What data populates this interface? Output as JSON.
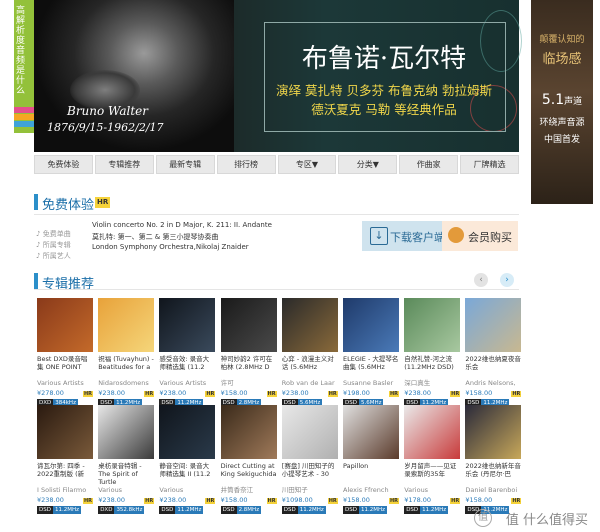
{
  "left_strip": {
    "text": "高解析度音频是什么",
    "tab_colors": [
      "#e44f8d",
      "#f5a623",
      "#3fa3d9",
      "#8b5ec8"
    ]
  },
  "banner": {
    "name": "Bruno Walter",
    "dates": "1876/9/15-1962/2/17",
    "title": "布鲁诺·瓦尔特",
    "line1": "演绎 莫扎特 贝多芬 布鲁克纳 勃拉姆斯",
    "line2": "德沃夏克 马勒 等经典作品"
  },
  "right_ad": {
    "t1": "颠覆认知的",
    "t2": "临场感",
    "t3_main": "5.1",
    "t3_small": "声道",
    "t4": "环绕声音源",
    "t5": "中国首发"
  },
  "nav": [
    {
      "label": "免费体验"
    },
    {
      "label": "专辑推荐"
    },
    {
      "label": "最新专辑"
    },
    {
      "label": "排行榜"
    },
    {
      "label": "专区▼"
    },
    {
      "label": "分类▼"
    },
    {
      "label": "作曲家"
    },
    {
      "label": "厂牌精选"
    }
  ],
  "free_trial": {
    "title": "免费体验",
    "badge": "HR",
    "rows": [
      {
        "key": "♪ 免费单曲",
        "value": "Violin concerto No. 2 in D Major, K. 211: II. Andante"
      },
      {
        "key": "♪ 所属专辑",
        "value": "莫扎特: 第一、第二 & 第三小提琴协奏曲"
      },
      {
        "key": "♪ 所属艺人",
        "value": "London Symphony Orchestra,Nikolaj Znaider"
      }
    ],
    "download_label": "下载客户端",
    "vip_label": "会员购买"
  },
  "recommend": {
    "title": "专辑推荐",
    "prev": "‹",
    "next": "›"
  },
  "albums": [
    {
      "title": "Best DXD录音唱集 ONE POINT",
      "artist": "Various Artists",
      "price": "¥278.00",
      "fmt_l": "DXD",
      "fmt_r": "384kHz",
      "colors": [
        "#8a3a1a",
        "#c46a2a"
      ]
    },
    {
      "title": "祝福 (Tuvayhun) - Beatitudes for a",
      "artist": "Nidarosdomens",
      "price": "¥238.00",
      "fmt_l": "DSD",
      "fmt_r": "11.2MHz",
      "colors": [
        "#e8a23a",
        "#f5d67a"
      ]
    },
    {
      "title": "感受音效: 录音大师精选集 (11.2",
      "artist": "Various Artists",
      "price": "¥238.00",
      "fmt_l": "DSD",
      "fmt_r": "11.2MHz",
      "colors": [
        "#10151c",
        "#3a4a5c"
      ]
    },
    {
      "title": "神司妙韵2 许可在柏林 (2.8MHz D",
      "artist": "许可",
      "price": "¥158.00",
      "fmt_l": "DSD",
      "fmt_r": "2.8MHz",
      "colors": [
        "#1a1a1a",
        "#4a4a4a"
      ]
    },
    {
      "title": "心弈 - 浪漫主义对话 (5.6MHz",
      "artist": "Rob van de Laar",
      "price": "¥238.00",
      "fmt_l": "DSD",
      "fmt_r": "5.6MHz",
      "colors": [
        "#2a2a2a",
        "#8a6a3a"
      ]
    },
    {
      "title": "ELEGIE - 大提琴名曲集 (5.6MHz",
      "artist": "Susanne Basler",
      "price": "¥198.00",
      "fmt_l": "DSD",
      "fmt_r": "5.6MHz",
      "colors": [
        "#1f3a6a",
        "#4a7ab8"
      ]
    },
    {
      "title": "自然礼赞-河之流 (11.2MHz DSD)",
      "artist": "深口真生",
      "price": "¥238.00",
      "fmt_l": "DSD",
      "fmt_r": "11.2MHz",
      "colors": [
        "#5a8a5a",
        "#a8c8a0"
      ]
    },
    {
      "title": "2022维也纳夏夜音乐会",
      "artist": "Andris Nelsons,",
      "price": "¥158.00",
      "fmt_l": "DSD",
      "fmt_r": "11.2MHz",
      "colors": [
        "#7aa8d8",
        "#c8b890"
      ]
    },
    {
      "title": "谛瓦尔第: 四季 - 2022重制版 (新",
      "artist": "I Solisti Filarmo",
      "price": "¥238.00",
      "fmt_l": "DSD",
      "fmt_r": "11.2MHz",
      "colors": [
        "#2a1a10",
        "#7a5a3a"
      ]
    },
    {
      "title": "桌枋录音特辑 - The Spirit of Turtle",
      "artist": "Various",
      "price": "¥238.00",
      "fmt_l": "DXD",
      "fmt_r": "352.8kHz",
      "colors": [
        "#e8e8e8",
        "#3a3a3a"
      ]
    },
    {
      "title": "静音空间: 录音大师精选集 II (11.2",
      "artist": "Various",
      "price": "¥238.00",
      "fmt_l": "DSD",
      "fmt_r": "11.2MHz",
      "colors": [
        "#10151c",
        "#2a3a4a"
      ]
    },
    {
      "title": "Direct Cutting at King Sekiguchida",
      "artist": "井筒香奈江",
      "price": "¥158.00",
      "fmt_l": "DSD",
      "fmt_r": "2.8MHz",
      "colors": [
        "#3a2a1a",
        "#a07a5a"
      ]
    },
    {
      "title": "[赛盘] 川田知子的小提琴艺术 - 30",
      "artist": "川田知子",
      "price": "¥1098.00",
      "fmt_l": "DSD",
      "fmt_r": "11.2MHz",
      "colors": [
        "#e8e8e8",
        "#b0b0b0"
      ]
    },
    {
      "title": "Papillon",
      "artist": "Alexis Ffrench",
      "price": "¥158.00",
      "fmt_l": "DSD",
      "fmt_r": "11.2MHz",
      "colors": [
        "#e0e0e0",
        "#5a3a2a"
      ]
    },
    {
      "title": "岁月留声——见证录索斯的35年",
      "artist": "Various",
      "price": "¥178.00",
      "fmt_l": "DSD",
      "fmt_r": "11.2MHz",
      "colors": [
        "#eaeaea",
        "#c83a3a"
      ]
    },
    {
      "title": "2022维也纳新年音乐会 (丹尼尔·巴",
      "artist": "Daniel Barenboi",
      "price": "¥158.00",
      "fmt_l": "DSD",
      "fmt_r": "11.2MHz",
      "colors": [
        "#2a2a3a",
        "#c8a85a"
      ]
    }
  ],
  "watermark": "值 什么值得买"
}
